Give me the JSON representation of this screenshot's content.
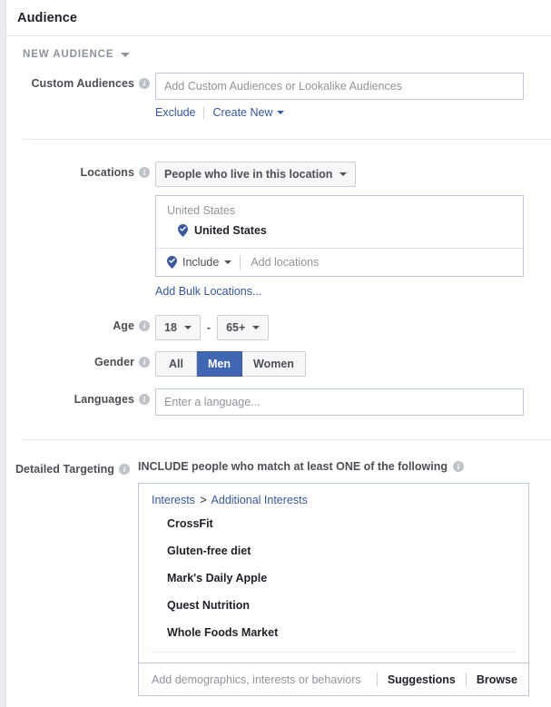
{
  "header": {
    "title": "Audience"
  },
  "audience_selector": {
    "label": "NEW AUDIENCE",
    "caret_icon": "chevron-down-icon"
  },
  "custom_audiences": {
    "label": "Custom Audiences",
    "info_icon": "info-icon",
    "input_value": "",
    "placeholder": "Add Custom Audiences or Lookalike Audiences",
    "exclude_link": "Exclude",
    "create_new_link": "Create New"
  },
  "locations": {
    "label": "Locations",
    "info_icon": "info-icon",
    "mode_dropdown": {
      "value": "People who live in this location",
      "caret_icon": "chevron-down-icon"
    },
    "group_heading": "United States",
    "selected": [
      {
        "name": "United States",
        "icon": "location-pin-check-icon"
      }
    ],
    "include_control": {
      "value": "Include",
      "icon": "location-pin-check-icon",
      "caret_icon": "chevron-down-icon"
    },
    "add_locations_placeholder": "Add locations",
    "add_locations_value": "",
    "bulk_link": "Add Bulk Locations..."
  },
  "age": {
    "label": "Age",
    "info_icon": "info-icon",
    "min": "18",
    "max": "65+",
    "separator": "-"
  },
  "gender": {
    "label": "Gender",
    "info_icon": "info-icon",
    "options": [
      "All",
      "Men",
      "Women"
    ],
    "selected": "Men",
    "selected_color": "#4267b2"
  },
  "languages": {
    "label": "Languages",
    "info_icon": "info-icon",
    "value": "",
    "placeholder": "Enter a language..."
  },
  "detailed_targeting": {
    "label": "Detailed Targeting",
    "info_icon": "info-icon",
    "heading": "INCLUDE people who match at least ONE of the following",
    "heading_info_icon": "info-icon",
    "breadcrumb": {
      "root": "Interests",
      "separator": ">",
      "child": "Additional Interests"
    },
    "items": [
      "CrossFit",
      "Gluten-free diet",
      "Mark's Daily Apple",
      "Quest Nutrition",
      "Whole Foods Market"
    ],
    "footer": {
      "placeholder": "Add demographics, interests or behaviors",
      "value": "",
      "suggestions_label": "Suggestions",
      "browse_label": "Browse"
    }
  },
  "theme": {
    "link_color": "#365899",
    "label_color": "#4b4f56",
    "text_color": "#1d2129",
    "placeholder_color": "#90949c",
    "border_color": "#bdc7d8",
    "page_bg": "#e9ebee"
  }
}
